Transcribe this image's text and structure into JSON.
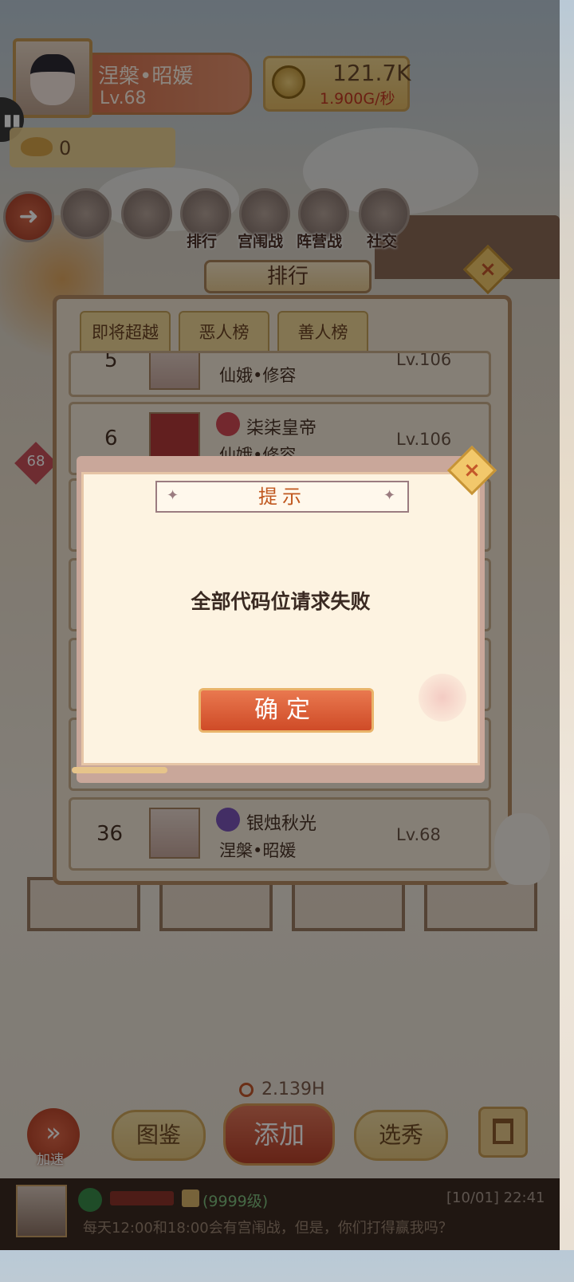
{
  "player": {
    "name": "涅槃•昭媛",
    "level": "Lv.68",
    "currency_amount": "121.7K",
    "currency_rate": "1.900G/秒",
    "ingot": "0"
  },
  "menu": {
    "items": [
      {
        "label": "",
        "icon": "ingot-icon"
      },
      {
        "label": "",
        "icon": "coin-icon"
      },
      {
        "label": "排行",
        "icon": "ranking-icon"
      },
      {
        "label": "宫闱战",
        "icon": "palace-war-icon"
      },
      {
        "label": "阵营战",
        "icon": "faction-war-icon"
      },
      {
        "label": "社交",
        "icon": "social-icon"
      }
    ]
  },
  "side_badge": "68",
  "ranking": {
    "title": "排行",
    "tabs": [
      "即将超越",
      "恶人榜",
      "善人榜"
    ],
    "rows": [
      {
        "rank": "5",
        "name": "",
        "title": "仙娥•修容",
        "level": "Lv.106"
      },
      {
        "rank": "6",
        "name": "柒柒皇帝",
        "title": "仙娥•修容",
        "level": "Lv.106"
      },
      {
        "rank": "36",
        "name": "银烛秋光",
        "title": "涅槃•昭媛",
        "level": "Lv.68"
      }
    ]
  },
  "dialog": {
    "title": "提示",
    "message": "全部代码位请求失败",
    "confirm_label": "确定"
  },
  "bottom": {
    "timer": "2.139H",
    "speed_label": "加速",
    "catalog_label": "图鉴",
    "add_label": "添加",
    "select_label": "选秀"
  },
  "chat": {
    "level_tag": "(9999级)",
    "time": "[10/01] 22:41",
    "message": "每天12:00和18:00会有宫闱战，但是，你们打得赢我吗？"
  },
  "colors": {
    "accent_red": "#cf4b27",
    "gold": "#e2b964",
    "title_orange": "#c0571e"
  }
}
